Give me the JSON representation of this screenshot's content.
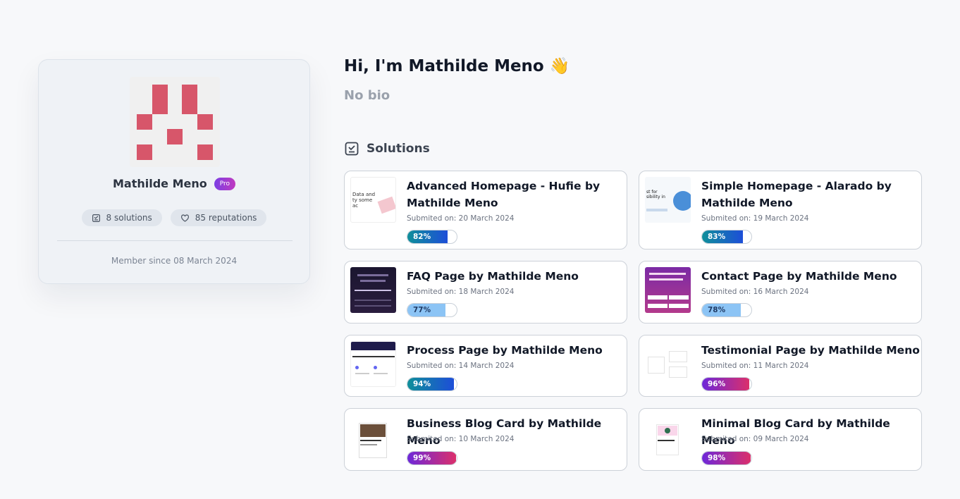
{
  "profile": {
    "name": "Mathilde Meno",
    "badge": "Pro",
    "solutions_count": "8 solutions",
    "reputations": "85 reputations",
    "member_since": "Member since 08 March 2024"
  },
  "header": {
    "greeting": "Hi, I'm Mathilde Meno 👋",
    "bio": "No bio"
  },
  "solutions_section": {
    "title": "Solutions"
  },
  "solutions": [
    {
      "title": "Advanced Homepage - Hufie by Mathilde Meno",
      "date": "Submited on: 20 March 2024",
      "score": "82%",
      "score_value": 82,
      "color": "teal"
    },
    {
      "title": "Simple Homepage - Alarado by Mathilde Meno",
      "date": "Submited on: 19 March 2024",
      "score": "83%",
      "score_value": 83,
      "color": "teal"
    },
    {
      "title": "FAQ Page by Mathilde Meno",
      "date": "Submited on: 18 March 2024",
      "score": "77%",
      "score_value": 77,
      "color": "light"
    },
    {
      "title": "Contact Page by Mathilde Meno",
      "date": "Submited on: 16 March 2024",
      "score": "78%",
      "score_value": 78,
      "color": "light"
    },
    {
      "title": "Process Page by Mathilde Meno",
      "date": "Submited on: 14 March 2024",
      "score": "94%",
      "score_value": 94,
      "color": "teal"
    },
    {
      "title": "Testimonial Page by Mathilde Meno",
      "date": "Submited on: 11 March 2024",
      "score": "96%",
      "score_value": 96,
      "color": "purple"
    },
    {
      "title": "Business Blog Card by Mathilde Meno",
      "date": "Submited on: 10 March 2024",
      "score": "99%",
      "score_value": 99,
      "color": "purple"
    },
    {
      "title": "Minimal Blog Card by Mathilde Meno",
      "date": "Submited on: 09 March 2024",
      "score": "98%",
      "score_value": 98,
      "color": "purple"
    }
  ],
  "colors": {
    "avatar_pixel": "#d7566a",
    "teal_gradient": "#0f8f9a",
    "purple_gradient": "#6d28d9",
    "light_bar": "#8cc4f5"
  }
}
